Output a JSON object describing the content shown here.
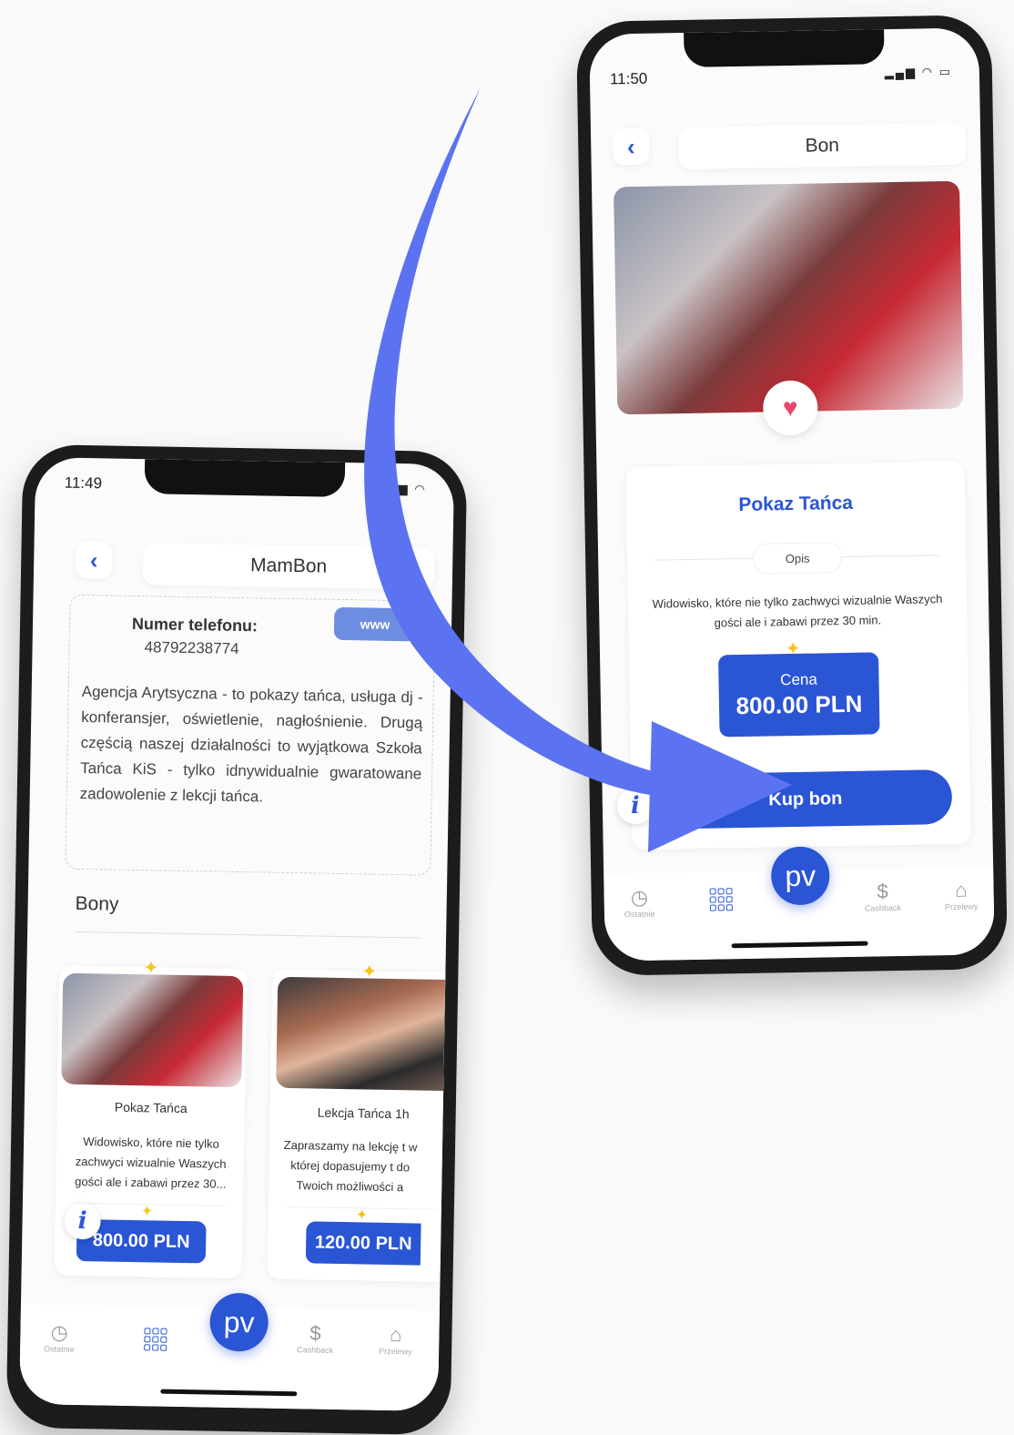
{
  "left_phone": {
    "status_time": "11:49",
    "title": "MamBon",
    "phone_label": "Numer telefonu:",
    "phone_value": "48792238774",
    "www_button": "www",
    "description": "Agencja Arytsyczna - to pokazy tańca, usługa dj - konferansjer, oświetlenie, nagłośnienie. Drugą częścią naszej działalności to wyjątkowa Szkoła Tańca KiS - tylko idnywidualnie gwaratowane zadowolenie z lekcji tańca.",
    "section_title": "Bony",
    "vouchers": [
      {
        "name": "Pokaz Tańca",
        "desc": "Widowisko, które nie tylko zachwyci wizualnie Waszych gości ale i zabawi przez 30...",
        "price": "800.00 PLN"
      },
      {
        "name": "Lekcja Tańca 1h",
        "desc": "Zapraszamy na lekcję t w której dopasujemy t do Twoich możliwości a",
        "price": "120.00 PLN"
      }
    ],
    "nav": {
      "recent": "Ostatnie",
      "cashback": "Cashback",
      "transfers": "Przelewy",
      "center": "pv"
    }
  },
  "right_phone": {
    "status_time": "11:50",
    "title": "Bon",
    "voucher_name": "Pokaz Tańca",
    "description_tab": "Opis",
    "description": "Widowisko, które nie tylko zachwyci wizualnie Waszych gości ale i zabawi przez 30 min.",
    "price_label": "Cena",
    "price": "800.00 PLN",
    "buy_button": "Kup bon",
    "nav": {
      "recent": "Ostatnie",
      "cashback": "Cashback",
      "transfers": "Przelewy",
      "center": "pv"
    }
  },
  "colors": {
    "accent": "#2a55d4",
    "arrow": "#5b73f0",
    "heart": "#e8476a"
  }
}
